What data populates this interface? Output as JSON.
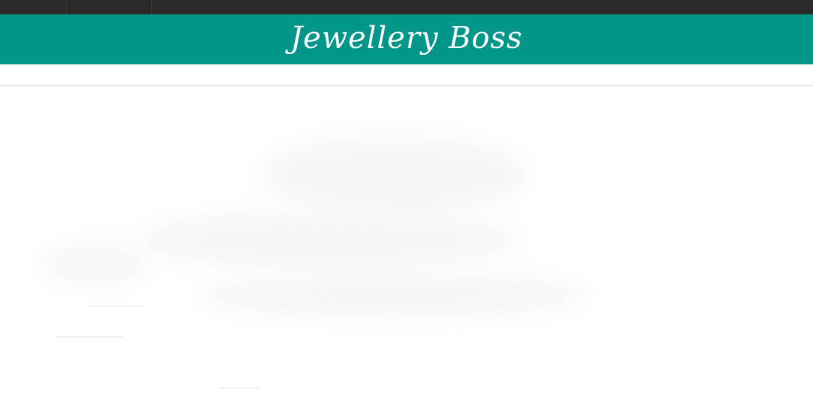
{
  "header": {
    "brand_title": "Jewellery Boss"
  },
  "colors": {
    "topbar": "#2a2a2a",
    "brand_header": "#00968a",
    "brand_text": "#ffffff",
    "divider": "#c4c4c4",
    "page_background": "#ffffff"
  }
}
